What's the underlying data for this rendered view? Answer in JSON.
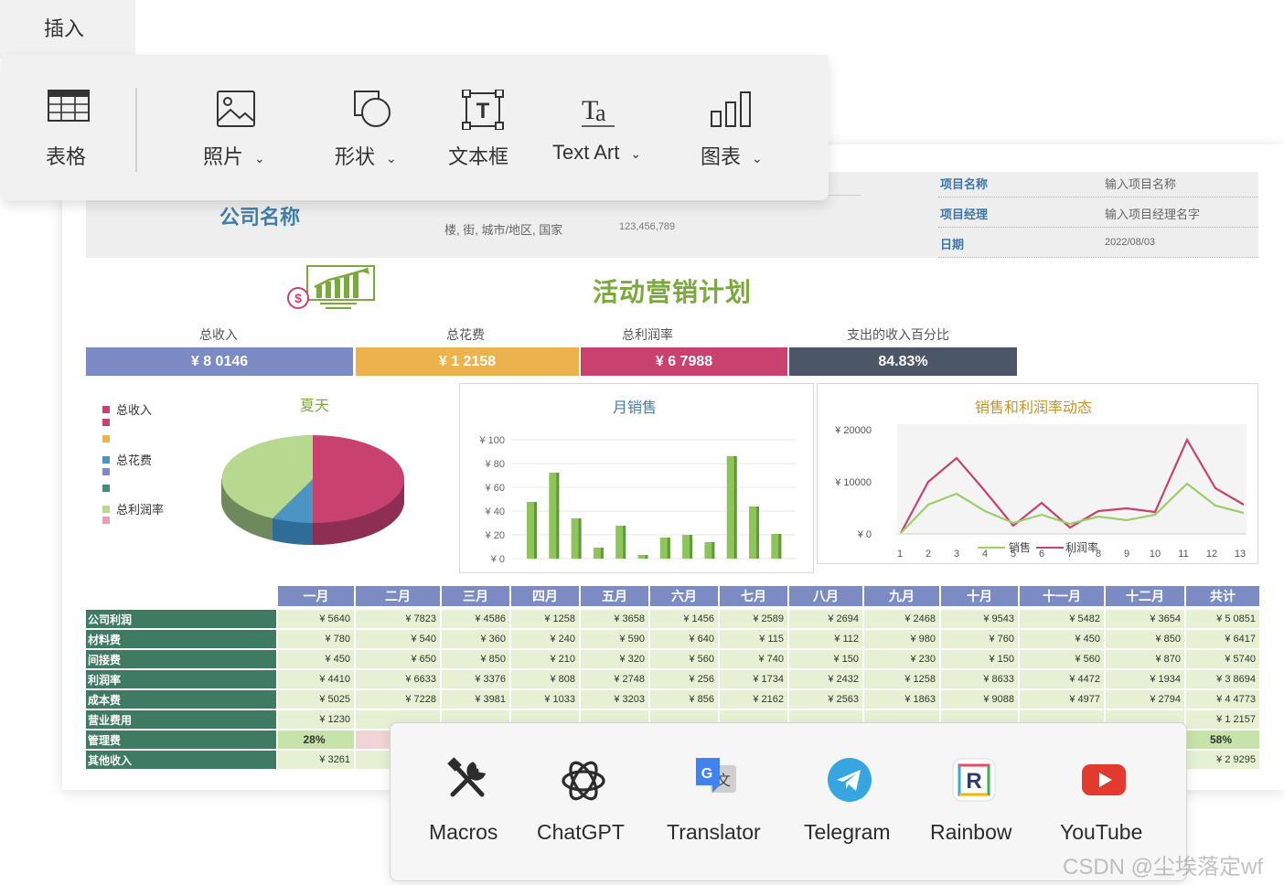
{
  "ribbon": {
    "tab_label": "插入",
    "items": [
      {
        "label": "表格",
        "icon": "table-icon",
        "dropdown": false
      },
      {
        "label": "照片",
        "icon": "photo-icon",
        "dropdown": true
      },
      {
        "label": "形状",
        "icon": "shape-icon",
        "dropdown": true
      },
      {
        "label": "文本框",
        "icon": "textbox-icon",
        "dropdown": false
      },
      {
        "label": "Text Art",
        "icon": "text-art-icon",
        "dropdown": true
      },
      {
        "label": "图表",
        "icon": "chart-icon",
        "dropdown": true
      }
    ],
    "chevron": "⌄"
  },
  "sheet": {
    "company": "公司名称",
    "address": "楼, 街, 城市/地区, 国家",
    "phone": "123,456,789",
    "info": [
      {
        "key": "项目名称",
        "value": "输入项目名称"
      },
      {
        "key": "项目经理",
        "value": "输入项目经理名字"
      },
      {
        "key": "日期",
        "value": "2022/08/03"
      }
    ],
    "title": "活动营销计划",
    "kpis": [
      {
        "label": "总收入",
        "value": "¥ 8 0146",
        "color": "#7d8bc4"
      },
      {
        "label": "总花费",
        "value": "¥ 1 2158",
        "color": "#ebb24d"
      },
      {
        "label": "总利润率",
        "value": "¥ 6 7988",
        "color": "#c9416f"
      },
      {
        "label": "支出的收入百分比",
        "value": "84.83%",
        "color": "#4b5667"
      }
    ],
    "pie": {
      "title": "夏天",
      "legend": [
        {
          "label": "总收入",
          "color": "#c9416f"
        },
        {
          "label": "",
          "color": "#c9416f"
        },
        {
          "label": "",
          "color": "#ebb24d"
        },
        {
          "label": "总花费",
          "color": "#4a95c4"
        },
        {
          "label": "",
          "color": "#7d8bc4"
        },
        {
          "label": "",
          "color": "#3f8f72"
        },
        {
          "label": "总利润率",
          "color": "#b6d88f"
        },
        {
          "label": "",
          "color": "#e8a0b8"
        }
      ]
    },
    "bar_chart": {
      "title": "月销售",
      "yticks": [
        "¥ 100",
        "¥ 80",
        "¥ 60",
        "¥ 40",
        "¥ 20",
        "¥ 0"
      ]
    },
    "line_chart": {
      "title": "销售和利润率动态",
      "yticks": [
        "¥ 20000",
        "¥ 10000",
        "¥ 0"
      ],
      "xticks": [
        "1",
        "2",
        "3",
        "4",
        "5",
        "6",
        "7",
        "8",
        "9",
        "10",
        "11",
        "12",
        "13"
      ],
      "legend": [
        "销售",
        "利润率"
      ]
    },
    "table": {
      "months": [
        "一月",
        "二月",
        "三月",
        "四月",
        "五月",
        "六月",
        "七月",
        "八月",
        "九月",
        "十月",
        "十一月",
        "十二月",
        "共计"
      ],
      "rows": [
        {
          "label": "公司利润",
          "cells": [
            "¥ 5640",
            "¥ 7823",
            "¥ 4586",
            "¥ 1258",
            "¥ 3658",
            "¥ 1456",
            "¥ 2589",
            "¥ 2694",
            "¥ 2468",
            "¥ 9543",
            "¥ 5482",
            "¥ 3654",
            "¥ 5 0851"
          ]
        },
        {
          "label": "材料费",
          "cells": [
            "¥ 780",
            "¥ 540",
            "¥ 360",
            "¥ 240",
            "¥ 590",
            "¥ 640",
            "¥ 115",
            "¥ 112",
            "¥ 980",
            "¥ 760",
            "¥ 450",
            "¥ 850",
            "¥ 6417"
          ]
        },
        {
          "label": "间接费",
          "cells": [
            "¥ 450",
            "¥ 650",
            "¥ 850",
            "¥ 210",
            "¥ 320",
            "¥ 560",
            "¥ 740",
            "¥ 150",
            "¥ 230",
            "¥ 150",
            "¥ 560",
            "¥ 870",
            "¥ 5740"
          ]
        },
        {
          "label": "利润率",
          "cells": [
            "¥ 4410",
            "¥ 6633",
            "¥ 3376",
            "¥ 808",
            "¥ 2748",
            "¥ 256",
            "¥ 1734",
            "¥ 2432",
            "¥ 1258",
            "¥ 8633",
            "¥ 4472",
            "¥ 1934",
            "¥ 3 8694"
          ]
        },
        {
          "label": "成本费",
          "cells": [
            "¥ 5025",
            "¥ 7228",
            "¥ 3981",
            "¥ 1033",
            "¥ 3203",
            "¥ 856",
            "¥ 2162",
            "¥ 2563",
            "¥ 1863",
            "¥ 9088",
            "¥ 4977",
            "¥ 2794",
            "¥ 4 4773"
          ]
        },
        {
          "label": "营业费用",
          "cells": [
            "¥ 1230",
            "",
            "",
            "",
            "",
            "",
            "",
            "",
            "",
            "",
            "",
            "",
            "¥ 1 2157"
          ]
        },
        {
          "label": "管理费",
          "cells": [
            "28%",
            "",
            "",
            "",
            "",
            "",
            "",
            "",
            "",
            "",
            "",
            "",
            "58%"
          ]
        },
        {
          "label": "其他收入",
          "cells": [
            "¥ 3261",
            "",
            "",
            "",
            "",
            "",
            "",
            "",
            "",
            "",
            "",
            "",
            "¥ 2 9295"
          ]
        }
      ]
    }
  },
  "addins": [
    {
      "label": "Macros",
      "icon": "macros-icon"
    },
    {
      "label": "ChatGPT",
      "icon": "chatgpt-icon"
    },
    {
      "label": "Translator",
      "icon": "translator-icon"
    },
    {
      "label": "Telegram",
      "icon": "telegram-icon"
    },
    {
      "label": "Rainbow",
      "icon": "rainbow-icon"
    },
    {
      "label": "YouTube",
      "icon": "youtube-icon"
    }
  ],
  "watermark": "CSDN @尘埃落定wf"
}
